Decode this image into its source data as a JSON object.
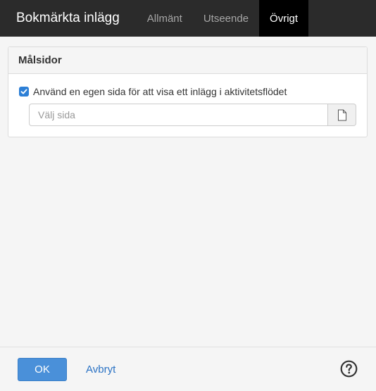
{
  "header": {
    "title": "Bokmärkta inlägg",
    "tabs": [
      {
        "label": "Allmänt",
        "active": false
      },
      {
        "label": "Utseende",
        "active": false
      },
      {
        "label": "Övrigt",
        "active": true
      }
    ]
  },
  "panel": {
    "title": "Målsidor",
    "checkbox": {
      "checked": true,
      "label": "Använd en egen sida för att visa ett inlägg i aktivitetsflödet"
    },
    "page_input": {
      "value": "",
      "placeholder": "Välj sida"
    },
    "picker_icon": "document-icon"
  },
  "footer": {
    "ok_label": "OK",
    "cancel_label": "Avbryt",
    "help_icon": "help-icon"
  },
  "colors": {
    "header_bg": "#2b2b2b",
    "active_tab_bg": "#000000",
    "accent": "#4a90d9",
    "link": "#2a72c4",
    "checkbox": "#2d7fd6"
  }
}
